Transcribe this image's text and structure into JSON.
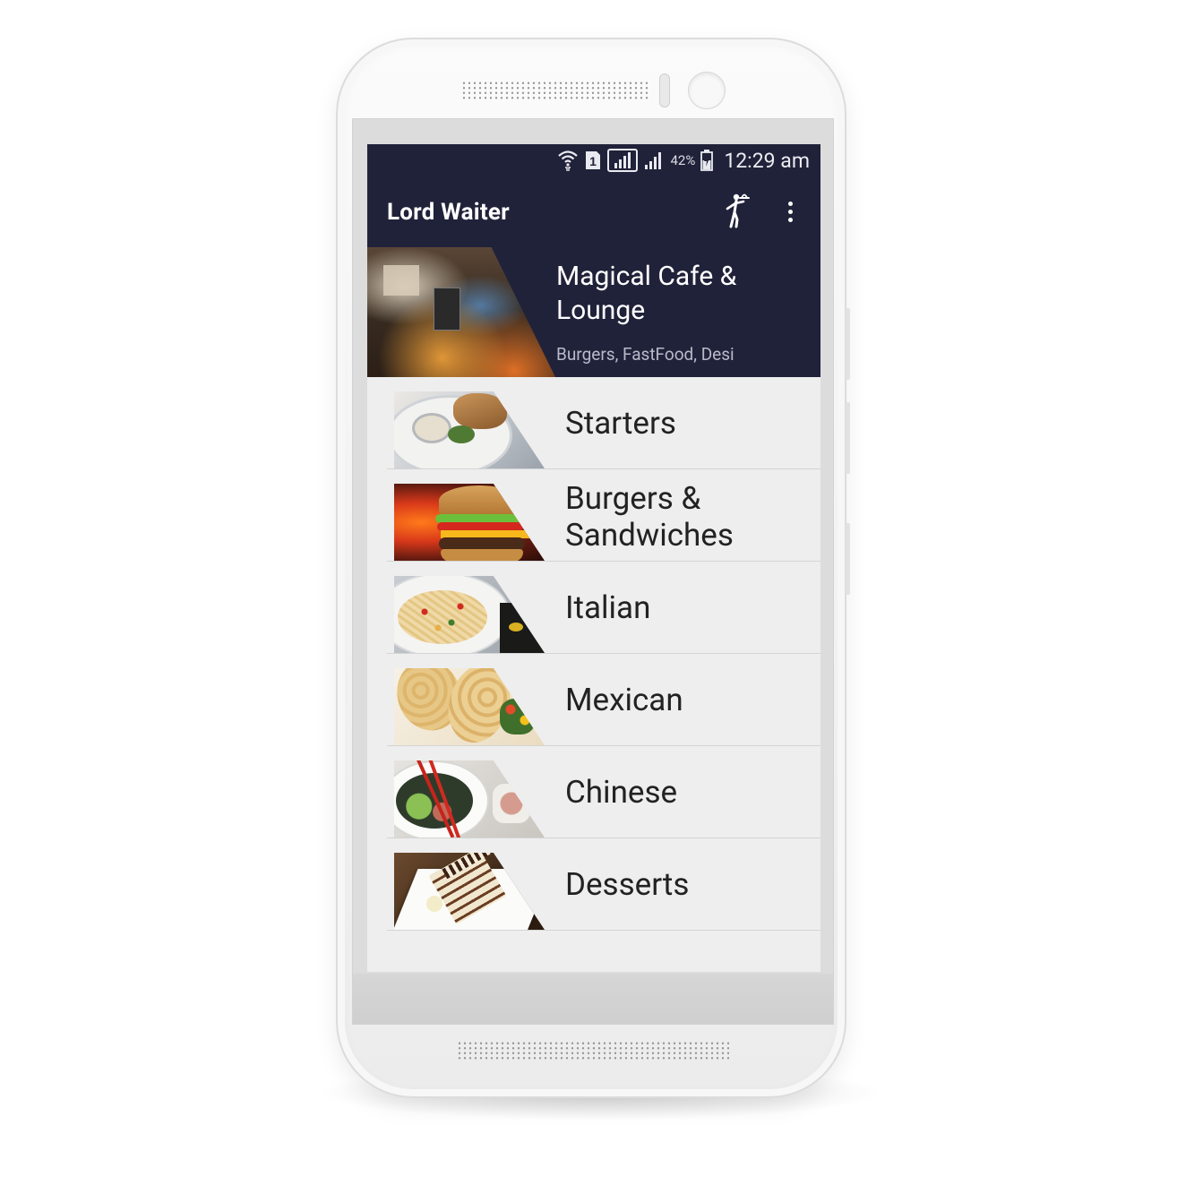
{
  "status_bar": {
    "battery_percent": "42%",
    "time": "12:29 am",
    "sim_slot": "1",
    "icons": [
      "wifi-icon",
      "sim-icon",
      "signal-icon",
      "signal-icon",
      "battery-charging-icon"
    ]
  },
  "app_bar": {
    "title": "Lord Waiter",
    "actions": [
      "waiter-icon",
      "more-vert-icon"
    ]
  },
  "restaurant": {
    "name": "Magical Cafe & Lounge",
    "cuisines": "Burgers, FastFood, Desi"
  },
  "categories": [
    {
      "label": "Starters",
      "image": "starters-thumbnail"
    },
    {
      "label": "Burgers & Sandwiches",
      "image": "burgers-thumbnail"
    },
    {
      "label": "Italian",
      "image": "italian-thumbnail"
    },
    {
      "label": "Mexican",
      "image": "mexican-thumbnail"
    },
    {
      "label": "Chinese",
      "image": "chinese-thumbnail"
    },
    {
      "label": "Desserts",
      "image": "desserts-thumbnail"
    }
  ],
  "colors": {
    "app_bar": "#20223a",
    "list_background": "#eeeeee",
    "label_text": "#222222",
    "header_subtext": "#b9bac8"
  }
}
